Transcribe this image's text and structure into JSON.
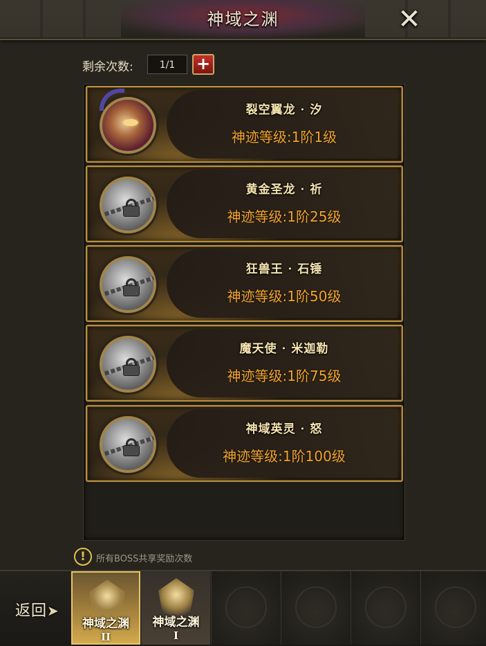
{
  "header": {
    "title": "神域之渊",
    "close_icon": "close-icon"
  },
  "attempts": {
    "label": "剩余次数:",
    "value": "1/1",
    "add_label": "+"
  },
  "bosses": [
    {
      "name": "裂空翼龙 · 汐",
      "level": "神迹等级:1阶1级",
      "locked": false
    },
    {
      "name": "黄金圣龙 · 祈",
      "level": "神迹等级:1阶25级",
      "locked": true
    },
    {
      "name": "狂兽王 · 石锤",
      "level": "神迹等级:1阶50级",
      "locked": true
    },
    {
      "name": "魔天使 · 米迦勒",
      "level": "神迹等级:1阶75级",
      "locked": true
    },
    {
      "name": "神域英灵 · 怒",
      "level": "神迹等级:1阶100级",
      "locked": true
    }
  ],
  "hint": {
    "icon": "warning-icon",
    "text": "所有BOSS共享奖励次数"
  },
  "footer": {
    "back_label": "返回",
    "tabs": [
      {
        "label": "神域之渊",
        "roman": "II",
        "active": true
      },
      {
        "label": "神域之渊",
        "roman": "I",
        "active": false
      }
    ]
  },
  "colors": {
    "accent_gold": "#b98f3f",
    "level_orange": "#f3a52c",
    "plus_red": "#c33128"
  }
}
